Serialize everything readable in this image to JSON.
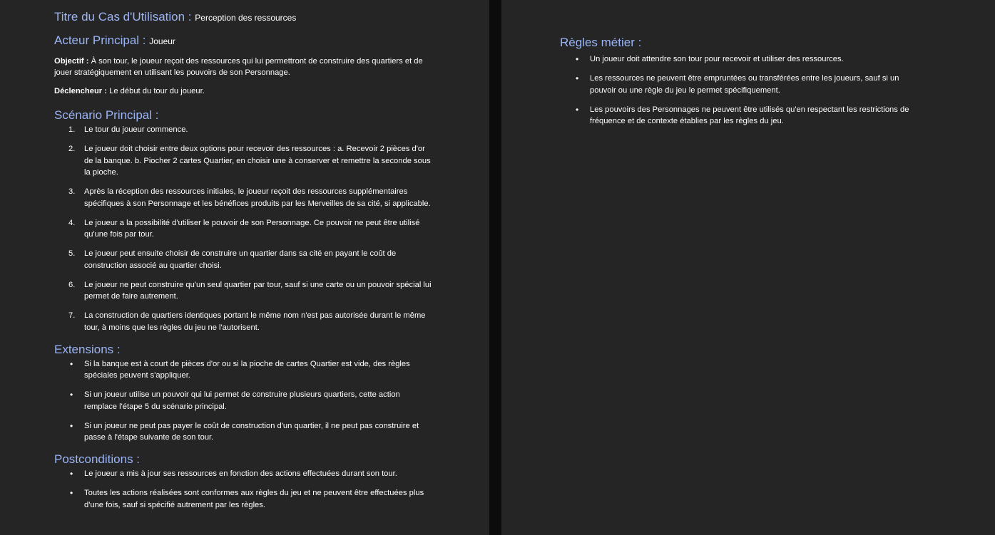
{
  "left_page": {
    "title_label": "Titre du Cas d'Utilisation :",
    "title_value": "Perception des ressources",
    "actor_label": "Acteur Principal :",
    "actor_value": "Joueur",
    "objective_label": "Objectif :",
    "objective_text": "À son tour, le joueur reçoit des ressources qui lui permettront de construire des quartiers et de jouer stratégiquement en utilisant les pouvoirs de son Personnage.",
    "trigger_label": "Déclencheur :",
    "trigger_text": "Le début du tour du joueur.",
    "scenario_heading": "Scénario Principal :",
    "scenario_steps": [
      {
        "marker": "1.",
        "text": "Le tour du joueur commence."
      },
      {
        "marker": "2.",
        "text": "Le joueur doit choisir entre deux options pour recevoir des ressources : a. Recevoir 2 pièces d'or de la banque. b. Piocher 2 cartes Quartier, en choisir une à conserver et remettre la seconde sous la pioche."
      },
      {
        "marker": "3.",
        "text": "Après la réception des ressources initiales, le joueur reçoit des ressources supplémentaires spécifiques à son Personnage et les bénéfices produits par les Merveilles de sa cité, si applicable."
      },
      {
        "marker": "4.",
        "text": "Le joueur a la possibilité d'utiliser le pouvoir de son Personnage. Ce pouvoir ne peut être utilisé qu'une fois par tour."
      },
      {
        "marker": "5.",
        "text": "Le joueur peut ensuite choisir de construire un quartier dans sa cité en payant le coût de construction associé au quartier choisi."
      },
      {
        "marker": "6.",
        "text": "Le joueur ne peut construire qu'un seul quartier par tour, sauf si une carte ou un pouvoir spécial lui permet de faire autrement."
      },
      {
        "marker": "7.",
        "text": "La construction de quartiers identiques portant le même nom n'est pas autorisée durant le même tour, à moins que les règles du jeu ne l'autorisent."
      }
    ],
    "extensions_heading": "Extensions :",
    "extensions": [
      "Si la banque est à court de pièces d'or ou si la pioche de cartes Quartier est vide, des règles spéciales peuvent s'appliquer.",
      "Si un joueur utilise un pouvoir qui lui permet de construire plusieurs quartiers, cette action remplace l'étape 5 du scénario principal.",
      "Si un joueur ne peut pas payer le coût de construction d'un quartier, il ne peut pas construire et passe à l'étape suivante de son tour."
    ],
    "postconditions_heading": "Postconditions :",
    "postconditions": [
      "Le joueur a mis à jour ses ressources en fonction des actions effectuées durant son tour.",
      "Toutes les actions réalisées sont conformes aux règles du jeu et ne peuvent être effectuées plus d'une fois, sauf si spécifié autrement par les règles."
    ]
  },
  "right_page": {
    "rules_heading": "Règles métier :",
    "rules": [
      "Un joueur doit attendre son tour pour recevoir et utiliser des ressources.",
      "Les ressources ne peuvent être empruntées ou transférées entre les joueurs, sauf si un pouvoir ou une règle du jeu le permet spécifiquement.",
      "Les pouvoirs des Personnages ne peuvent être utilisés qu'en respectant les restrictions de fréquence et de contexte établies par les règles du jeu."
    ]
  },
  "bullet_glyph": "•",
  "colors": {
    "page_background": "#252526",
    "gutter_background": "#0c0c0c",
    "heading_color": "#9ab4f5",
    "text_color": "#ffffff"
  }
}
